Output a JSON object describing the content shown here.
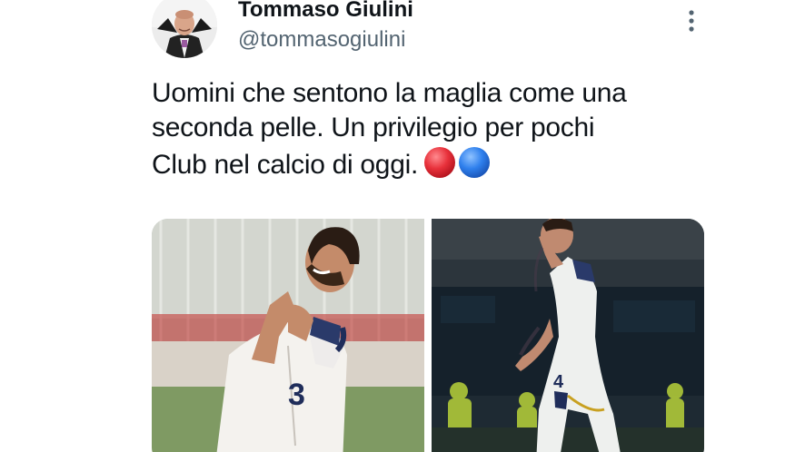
{
  "tweet": {
    "display_name": "Tommaso Giulini",
    "handle": "@tommasogiulini",
    "text_lines": [
      "Uomini che sentono la maglia come una",
      "seconda pelle. Un privilegio per pochi",
      "Club nel calcio di oggi."
    ],
    "emojis": [
      "red-circle",
      "blue-circle"
    ],
    "media": [
      {
        "icon": "player-celebration-photo"
      },
      {
        "icon": "player-kissing-badge-photo"
      }
    ]
  },
  "colors": {
    "text": "#0f1419",
    "secondary": "#536471",
    "red_circle": "#e8313b",
    "blue_circle": "#2f80ed"
  }
}
